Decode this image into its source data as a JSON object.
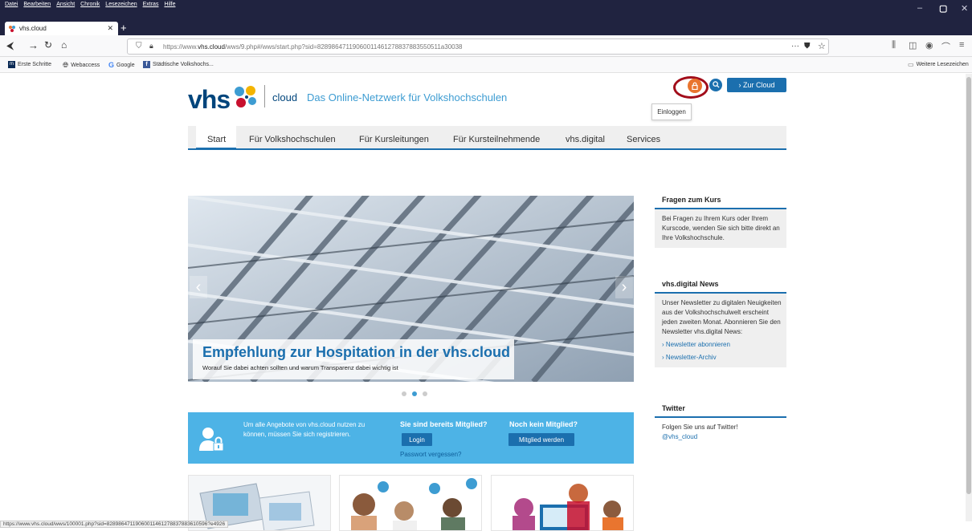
{
  "browser": {
    "menu": [
      "Datei",
      "Bearbeiten",
      "Ansicht",
      "Chronik",
      "Lesezeichen",
      "Extras",
      "Hilfe"
    ],
    "tab_title": "vhs.cloud",
    "url_prefix": "https://www.",
    "url_domain": "vhs.cloud",
    "url_rest": "/wws/9.php#/wws/start.php?sid=82898647119060011461278837883550511a30038",
    "url_more": "···",
    "bookmarks": [
      "Erste Schritte",
      "Webaccess",
      "Google",
      "Städtische Volkshochs..."
    ],
    "bookmarks_other": "Weitere Lesezeichen",
    "status_url": "https://www.vhs.cloud/wws/100001.php?sid=82898647119060011461278837883610596?e4926"
  },
  "header": {
    "logo_text": "vhs",
    "logo_cloud": "cloud",
    "tagline": "Das Online-Netzwerk für Volkshochschulen",
    "to_cloud": "› Zur Cloud",
    "login_tooltip": "Einloggen"
  },
  "nav": [
    "Start",
    "Für Volkshochschulen",
    "Für Kursleitungen",
    "Für Kursteilnehmende",
    "vhs.digital",
    "Services"
  ],
  "slider": {
    "title": "Empfehlung zur Hospitation in der vhs.cloud",
    "subtitle": "Worauf Sie dabei achten sollten und warum Transparenz dabei wichtig ist",
    "prev": "‹",
    "next": "›",
    "active_index": 1
  },
  "register": {
    "text": "Um alle Angebote von vhs.cloud nutzen zu können, müssen Sie sich registrieren.",
    "member_heading": "Sie sind bereits Mitglied?",
    "login": "Login",
    "forgot": "Passwort vergessen?",
    "nonmember_heading": "Noch kein Mitglied?",
    "become_member": "Mitglied werden"
  },
  "sidebar": {
    "course": {
      "title": "Fragen zum Kurs",
      "text": "Bei Fragen zu Ihrem Kurs oder Ihrem Kurscode, wenden Sie sich bitte direkt an Ihre Volkshochschule."
    },
    "news": {
      "title": "vhs.digital News",
      "text": "Unser Newsletter zu digitalen Neuigkeiten aus der Volkshochschulwelt erscheint jeden zweiten Monat. Abonnieren Sie den Newsletter vhs.digital News:",
      "link1": "› Newsletter abonnieren",
      "link2": "› Newsletter-Archiv"
    },
    "twitter": {
      "title": "Twitter",
      "text": "Folgen Sie uns auf Twitter!",
      "handle": "@vhs_cloud"
    }
  },
  "colors": {
    "brand_blue": "#1b6fae",
    "band_blue": "#4db3e6",
    "lock_orange": "#e9752f",
    "highlight_red": "#a20d1a"
  }
}
